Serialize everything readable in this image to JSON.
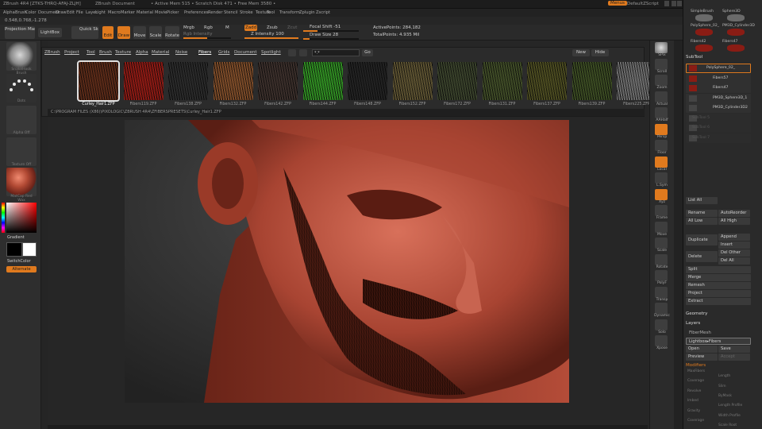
{
  "titlebar": {
    "app": "ZBrush 4R4 [ZTKS-THRQ-AFAJ-ZLJH]",
    "document": "ZBrush Document",
    "memory": "• Active Mem 515  • Scratch Disk 471  • Free Mem 3580 •",
    "menus_button": "Menus",
    "default_script": "DefaultZScript"
  },
  "menubar": [
    "Alpha",
    "Brush",
    "Color",
    "Document",
    "Draw",
    "Edit",
    "File",
    "Layer",
    "Light",
    "Macro",
    "Marker",
    "Material",
    "Movie",
    "Picker",
    "Preferences",
    "Render",
    "Stencil",
    "Stroke",
    "Texture",
    "Tool",
    "Transform",
    "Zplugin",
    "Zscript"
  ],
  "coords": "0.548,0.768,-1.278",
  "toolbar": {
    "projection_master": "Projection Master",
    "lightbox": "LightBox",
    "quick_sketch": "Quick Sketch",
    "edit": "Edit",
    "draw": "Draw",
    "move": "Move",
    "scale": "Scale",
    "rotate": "Rotate",
    "mrgb": "Mrgb",
    "rgb": "Rgb",
    "m": "M",
    "rgb_intensity": "Rgb Intensity",
    "zadd": "Zadd",
    "zsub": "Zsub",
    "zcut": "Zcut",
    "z_intensity": "Z Intensity 100",
    "focal_shift": "Focal Shift -51",
    "draw_size": "Draw Size 28",
    "active_points": "ActivePoints: 284,182",
    "total_points": "TotalPoints: 4.935 Mil"
  },
  "toolbar_levels": {
    "rgb_intensity": 0.5,
    "z_intensity": 1.0,
    "focal_shift": 0.25,
    "draw_size": 0.12
  },
  "left_shelf": {
    "brush_caption": "SnakeHook Brush",
    "stroke_caption": "Dots",
    "alpha_caption": "Alpha Off",
    "texture_caption": "Texture Off",
    "material_caption": "MatCap Red Wax",
    "gradient": "Gradient",
    "switch_color": "SwitchColor",
    "alternate": "Alternate"
  },
  "lightbox": {
    "tabs": [
      "ZBrush",
      "Project",
      "Tool",
      "Brush",
      "Texture",
      "Alpha",
      "Material",
      "Noise",
      "Fibers",
      "Grids",
      "Document",
      "Spotlight"
    ],
    "active_tab": "Fibers",
    "search_value": "*.*",
    "go": "Go",
    "new": "New",
    "hide": "Hide",
    "items": [
      {
        "name": "Curley_Hair1.ZFP",
        "color": "#5a2a18",
        "selected": true
      },
      {
        "name": "Fibers119.ZFP",
        "color": "#8a1a14"
      },
      {
        "name": "Fibers138.ZFP",
        "color": "#2a2a2a"
      },
      {
        "name": "Fibers132.ZFP",
        "color": "#7a4a28"
      },
      {
        "name": "Fibers142.ZFP",
        "color": "#3a2e2a"
      },
      {
        "name": "Fibers144.ZFP",
        "color": "#2f8a22"
      },
      {
        "name": "Fibers148.ZFP",
        "color": "#222222"
      },
      {
        "name": "Fibers152.ZFP",
        "color": "#5a5030"
      },
      {
        "name": "Fibers172.ZFP",
        "color": "#38402a"
      },
      {
        "name": "Fibers131.ZFP",
        "color": "#3e4a26"
      },
      {
        "name": "Fibers137.ZFP",
        "color": "#4a4a20"
      },
      {
        "name": "Fibers139.ZFP",
        "color": "#3a4a22"
      },
      {
        "name": "Fibers225.ZFP",
        "color": "#6a6a6a"
      }
    ],
    "path": "C:\\PROGRAM FILES (X86)\\PIXOLOGIC\\ZBRUSH 4R4\\ZFIBERSPRESETS\\Curley_Hair1.ZFP"
  },
  "right_shelf": [
    "SPix",
    "Scroll",
    "Zoom",
    "Actual",
    "AAHalf",
    "Persp",
    "Floor",
    "Local",
    "L.Sym",
    "Xyz",
    "Frame",
    "Move",
    "Scale",
    "Rotate",
    "PolyF",
    "Transp",
    "Dynamic",
    "Solo",
    "Xpose"
  ],
  "tray": {
    "tool_items": [
      "SimpleBrush",
      "Sphere3D",
      "PolySphere_02_",
      "PM3D_Cylinder3D",
      "Fibers42",
      "Fibers47"
    ],
    "subtool": "SubTool",
    "subtools": [
      "PolySphere_02_",
      "Fibers57",
      "Fibers47",
      "PM3D_Sphere3D_1",
      "PM3D_Cylinder3D2",
      "SubTool 5",
      "SubTool 6",
      "SubTool 7"
    ],
    "list_all": "List All",
    "rename": "Rename",
    "auto_reorder": "AutoReorder",
    "all_low": "All Low",
    "all_high": "All High",
    "duplicate": "Duplicate",
    "append": "Append",
    "insert": "Insert",
    "delete": "Delete",
    "del_other": "Del Other",
    "del_all": "Del All",
    "split": "Split",
    "merge": "Merge",
    "remesh": "Remesh",
    "project": "Project",
    "extract": "Extract",
    "geometry": "Geometry",
    "layers": "Layers",
    "fibermesh": "FiberMesh",
    "lightbox_fibers": "Lightbox▸Fibers",
    "open": "Open",
    "save": "Save",
    "preview": "Preview",
    "accept": "Accept",
    "modifiers": "Modifiers",
    "mod_rows": [
      "MaxFibers",
      "Length",
      "Coverage",
      "Slim",
      "Revolve",
      "ByMask",
      "Imbed",
      "Length Profile",
      "Gravity",
      "Width Profile",
      "Coverage",
      "Scale Root"
    ]
  }
}
